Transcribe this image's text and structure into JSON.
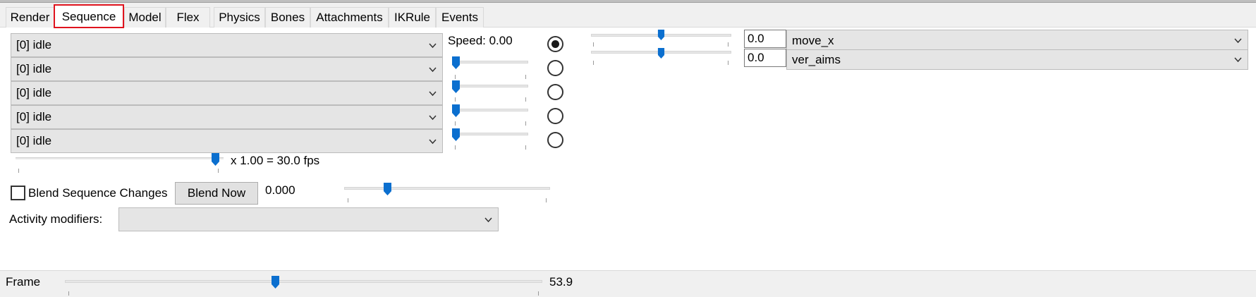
{
  "tabs": [
    {
      "label": "Render"
    },
    {
      "label": "Sequence"
    },
    {
      "label": "Model"
    },
    {
      "label": "Flex"
    },
    {
      "label": "Physics"
    },
    {
      "label": "Bones"
    },
    {
      "label": "Attachments"
    },
    {
      "label": "IKRule"
    },
    {
      "label": "Events"
    }
  ],
  "active_tab": "Sequence",
  "sequences": [
    {
      "value": "[0] idle",
      "slider_value": 0,
      "selected": true
    },
    {
      "value": "[0] idle",
      "slider_value": 0,
      "selected": false
    },
    {
      "value": "[0] idle",
      "slider_value": 0,
      "selected": false
    },
    {
      "value": "[0] idle",
      "slider_value": 0,
      "selected": false
    },
    {
      "value": "[0] idle",
      "slider_value": 0,
      "selected": false
    }
  ],
  "speed": {
    "label": "Speed: 0.00"
  },
  "playback": {
    "text": "x 1.00 = 30.0 fps",
    "slider_fraction": 0.98
  },
  "blend": {
    "checkbox_label": "Blend Sequence Changes",
    "checked": false,
    "button_label": "Blend Now",
    "value": "0.000",
    "slider_fraction": 0.2
  },
  "activity": {
    "label": "Activity modifiers:",
    "value": ""
  },
  "pose_params": [
    {
      "value": "0.0",
      "name": "move_x",
      "slider_fraction": 0.5
    },
    {
      "value": "0.0",
      "name": "ver_aims",
      "slider_fraction": 0.5
    }
  ],
  "frame": {
    "label": "Frame",
    "value": "53.9",
    "slider_fraction": 0.44
  },
  "colors": {
    "thumb": "#0b6fcf",
    "active_tab_border": "#e0141e"
  }
}
